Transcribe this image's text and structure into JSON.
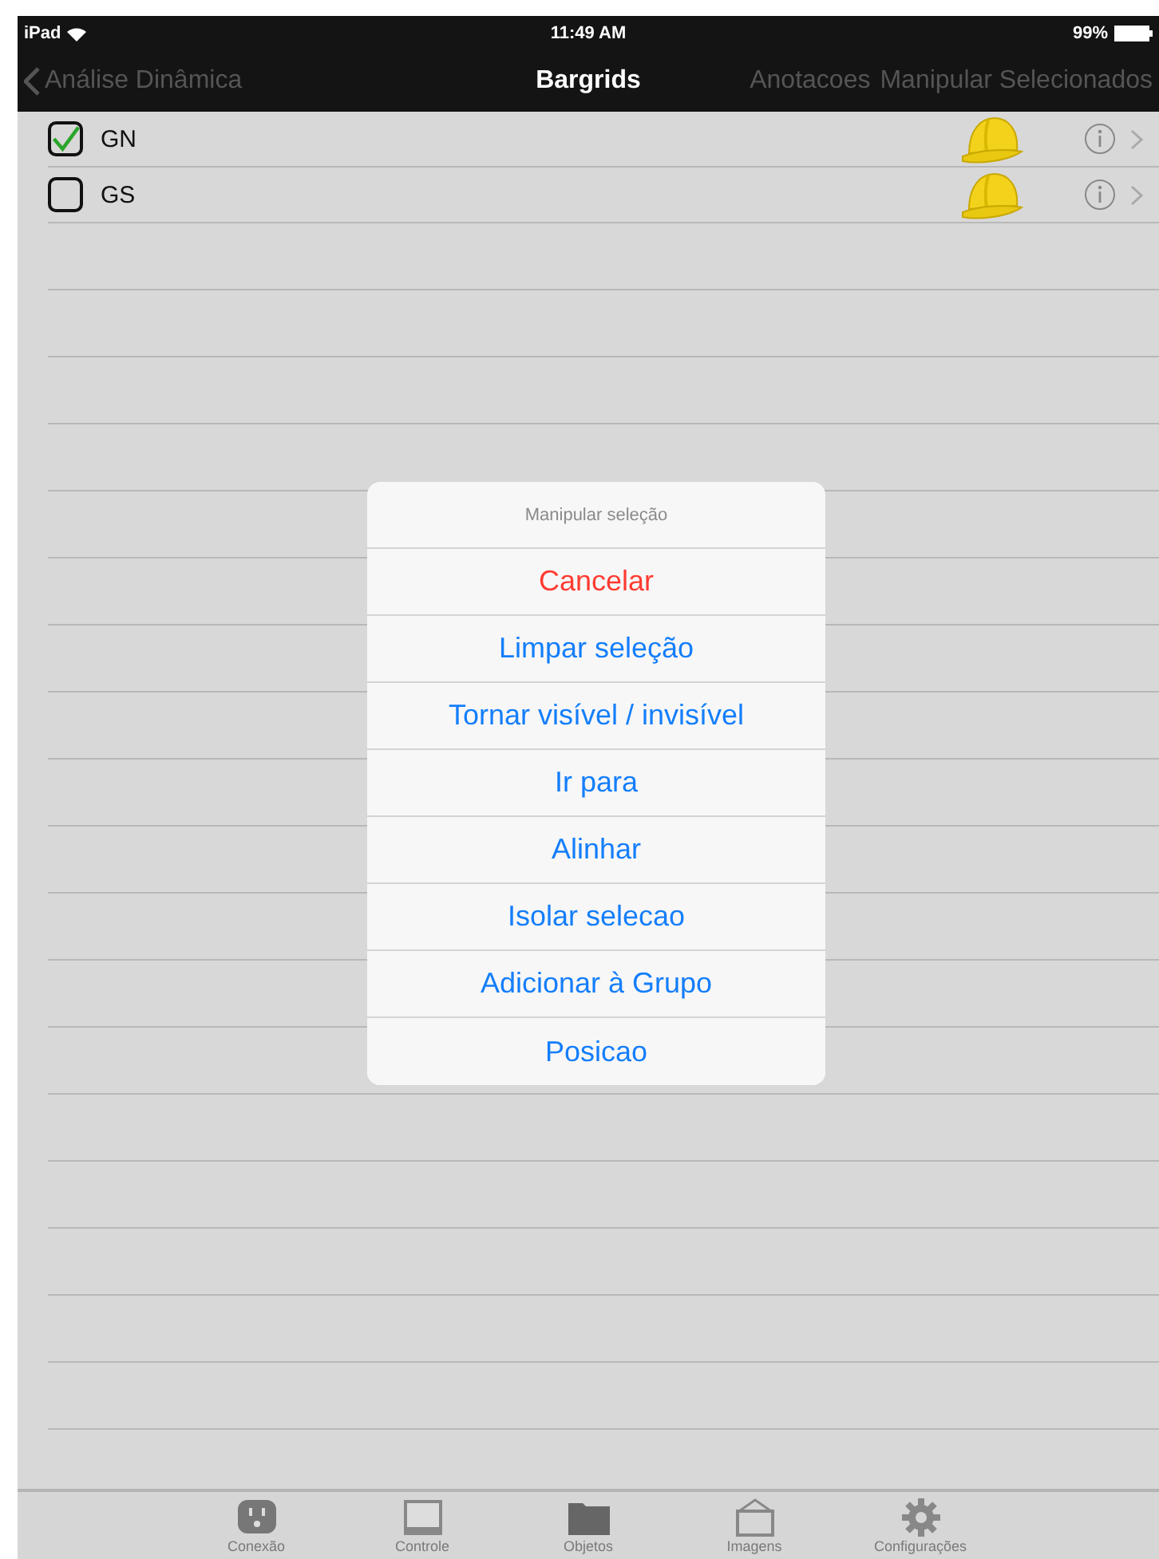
{
  "status_bar": {
    "device": "iPad",
    "time": "11:49 AM",
    "battery": "99%"
  },
  "nav_bar": {
    "back": "Análise Dinâmica",
    "title": "Bargrids",
    "actions": [
      "Anotacoes",
      "Manipular Selecionados"
    ]
  },
  "rows": [
    {
      "label": "GN",
      "checked": true
    },
    {
      "label": "GS",
      "checked": false
    }
  ],
  "action_sheet": {
    "title": "Manipular seleção",
    "items": [
      {
        "label": "Cancelar",
        "kind": "destructive"
      },
      {
        "label": "Limpar seleção",
        "kind": "default"
      },
      {
        "label": "Tornar visível / invisível",
        "kind": "default"
      },
      {
        "label": "Ir para",
        "kind": "default"
      },
      {
        "label": "Alinhar",
        "kind": "default"
      },
      {
        "label": "Isolar selecao",
        "kind": "default"
      },
      {
        "label": "Adicionar à Grupo",
        "kind": "default"
      },
      {
        "label": "Posicao",
        "kind": "default"
      }
    ]
  },
  "tab_bar": [
    {
      "label": "Conexão",
      "kind": "outlet"
    },
    {
      "label": "Controle",
      "kind": "monitor"
    },
    {
      "label": "Objetos",
      "kind": "folder"
    },
    {
      "label": "Imagens",
      "kind": "frame"
    },
    {
      "label": "Configurações",
      "kind": "gear"
    }
  ]
}
